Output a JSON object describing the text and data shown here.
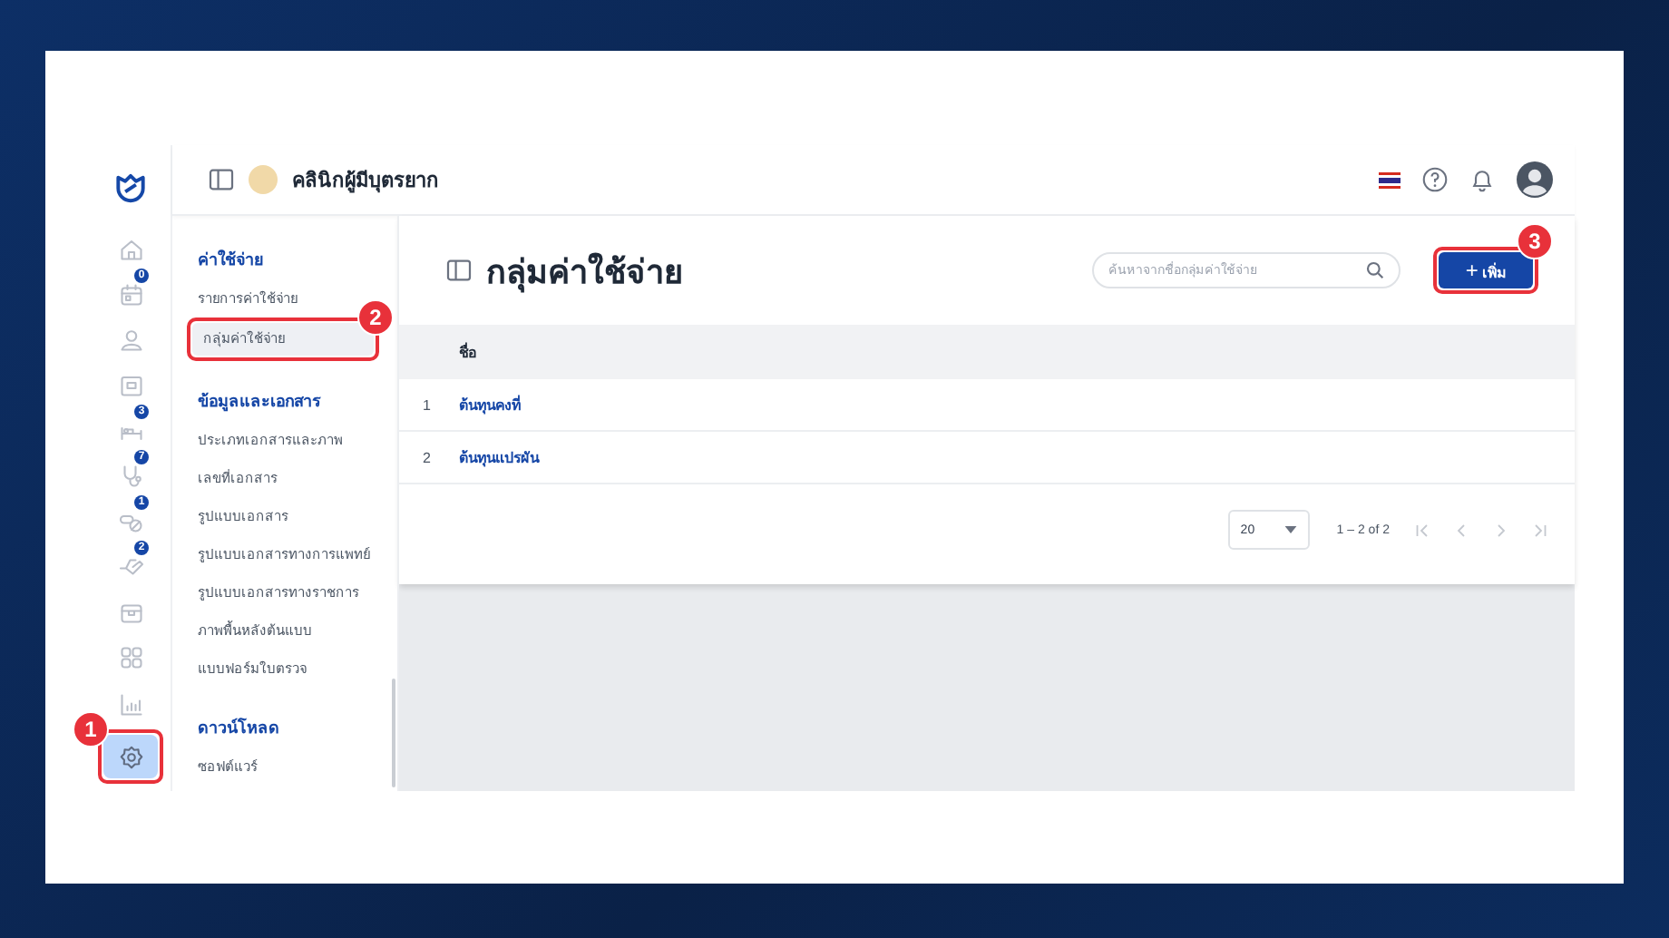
{
  "rail": {
    "items": [
      {
        "kind": "home",
        "selected": false
      },
      {
        "kind": "calendar",
        "selected": false,
        "badge": "0"
      },
      {
        "kind": "person",
        "selected": false
      },
      {
        "kind": "card",
        "selected": false
      },
      {
        "kind": "bed",
        "selected": false,
        "badge": "3"
      },
      {
        "kind": "stethoscope",
        "selected": false,
        "badge": "7"
      },
      {
        "kind": "pills",
        "selected": false,
        "badge": "1"
      },
      {
        "kind": "hand",
        "selected": false,
        "badge": "2"
      },
      {
        "kind": "box",
        "selected": false
      },
      {
        "kind": "grid",
        "selected": false
      },
      {
        "kind": "chart",
        "selected": false
      },
      {
        "kind": "settings",
        "selected": true,
        "callout": "1"
      }
    ]
  },
  "header": {
    "clinic_name": "คลินิกผู้มีบุตรยาก"
  },
  "submenu": {
    "sections": [
      {
        "title": "ค่าใช้จ่าย",
        "items": [
          {
            "label": "รายการค่าใช้จ่าย",
            "selected": false
          },
          {
            "label": "กลุ่มค่าใช้จ่าย",
            "selected": true,
            "callout": "2"
          }
        ]
      },
      {
        "title": "ข้อมูลและเอกสาร",
        "items": [
          {
            "label": "ประเภทเอกสารและภาพ",
            "selected": false
          },
          {
            "label": "เลขที่เอกสาร",
            "selected": false
          },
          {
            "label": "รูปแบบเอกสาร",
            "selected": false
          },
          {
            "label": "รูปแบบเอกสารทางการแพทย์",
            "selected": false
          },
          {
            "label": "รูปแบบเอกสารทางราชการ",
            "selected": false
          },
          {
            "label": "ภาพพื้นหลังต้นแบบ",
            "selected": false
          },
          {
            "label": "แบบฟอร์มใบตรวจ",
            "selected": false
          }
        ]
      },
      {
        "title": "ดาวน์โหลด",
        "items": [
          {
            "label": "ซอฟต์แวร์",
            "selected": false
          }
        ]
      }
    ]
  },
  "page": {
    "title": "กลุ่มค่าใช้จ่าย",
    "search": {
      "placeholder": "ค้นหาจากชื่อกลุ่มค่าใช้จ่าย"
    },
    "add_button": {
      "icon": "+",
      "label": "เพิ่ม",
      "callout": "3"
    }
  },
  "table": {
    "columns": [
      "ชื่อ"
    ],
    "rows": [
      {
        "index": "1",
        "name": "ต้นทุนคงที่"
      },
      {
        "index": "2",
        "name": "ต้นทุนแปรผัน"
      }
    ]
  },
  "pagination": {
    "page_size": "20",
    "range": "1 – 2 of 2"
  }
}
